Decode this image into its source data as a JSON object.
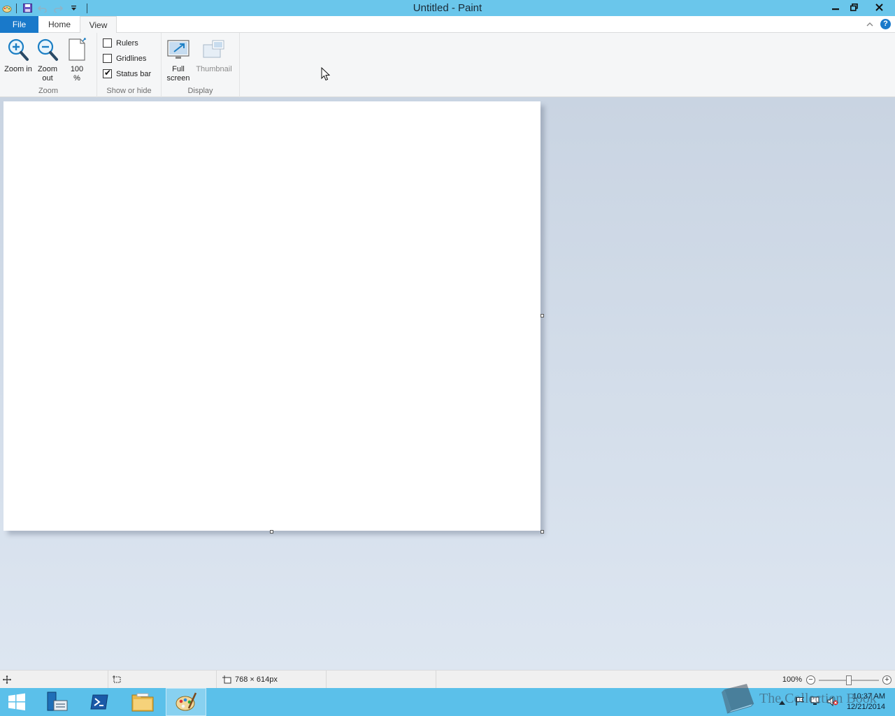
{
  "window": {
    "title": "Untitled - Paint",
    "minimize_glyph": "–",
    "restore_glyph": "❐",
    "close_glyph": "✕"
  },
  "quick_access": {
    "icons": [
      "paint-app-icon",
      "save-icon",
      "undo-icon",
      "redo-icon",
      "customize-qat-icon"
    ]
  },
  "tabs": {
    "file": "File",
    "home": "Home",
    "view": "View",
    "active": "View"
  },
  "ribbon": {
    "zoom_group": {
      "label": "Zoom",
      "zoom_in": "Zoom in",
      "zoom_out": "Zoom out",
      "hundred": "100 %"
    },
    "show_hide_group": {
      "label": "Show or hide",
      "rulers": {
        "label": "Rulers",
        "checked": false
      },
      "gridlines": {
        "label": "Gridlines",
        "checked": false
      },
      "status_bar": {
        "label": "Status bar",
        "checked": true
      }
    },
    "display_group": {
      "label": "Display",
      "full_screen": "Full screen",
      "thumbnail": "Thumbnail"
    }
  },
  "statusbar": {
    "canvas_size": "768 × 614px",
    "zoom_level": "100%",
    "zoom_fraction": 0.5
  },
  "taskbar": {
    "time": "10:37 AM",
    "date": "12/21/2014",
    "apps": [
      "windows-start-icon",
      "server-manager-icon",
      "powershell-icon",
      "file-explorer-icon",
      "paint-icon"
    ],
    "active_app": "paint-icon"
  },
  "watermark": {
    "text": "The Collection Book"
  },
  "colors": {
    "title_bar": "#6ac6eb",
    "file_tab": "#1979ca",
    "taskbar": "#5bc0ea",
    "workspace": "#dde6f1"
  }
}
